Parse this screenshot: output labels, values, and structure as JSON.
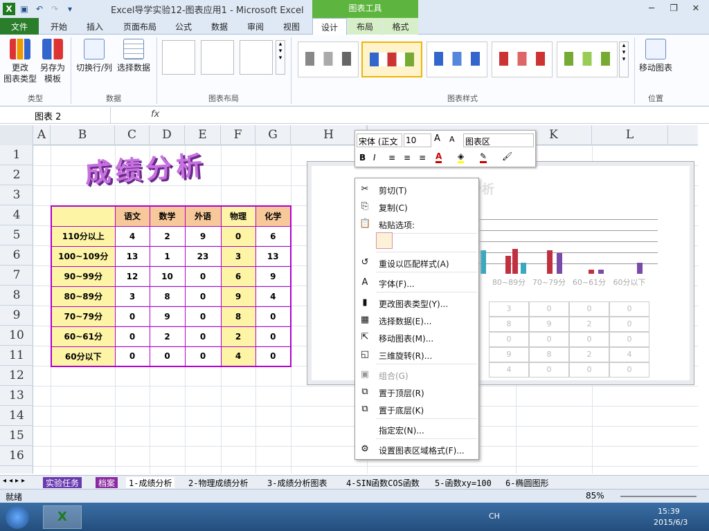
{
  "window": {
    "title": "Excel导学实验12-图表应用1  -  Microsoft Excel",
    "chart_tools_label": "图表工具"
  },
  "tabs": [
    "文件",
    "开始",
    "插入",
    "页面布局",
    "公式",
    "数据",
    "审阅",
    "视图",
    "设计",
    "布局",
    "格式"
  ],
  "ribbon": {
    "change_type": "更改\n图表类型",
    "save_template": "另存为\n模板",
    "group_type": "类型",
    "switch_rowcol": "切换行/列",
    "select_data": "选择数据",
    "group_data": "数据",
    "group_layout": "图表布局",
    "group_style": "图表样式",
    "move_chart": "移动图表",
    "group_position": "位置"
  },
  "formula_bar": {
    "name": "图表 2",
    "fx": "fx"
  },
  "columns": [
    "A",
    "B",
    "C",
    "D",
    "E",
    "F",
    "G",
    "H",
    "I",
    "J",
    "K",
    "L"
  ],
  "rows": [
    "1",
    "2",
    "3",
    "4",
    "5",
    "6",
    "7",
    "8",
    "9",
    "10",
    "11",
    "12",
    "13",
    "14",
    "15",
    "16"
  ],
  "sheet_title": "成绩分析",
  "table": {
    "headers": [
      "语文",
      "数学",
      "外语",
      "物理",
      "化学"
    ],
    "rows": [
      {
        "label": "110分以上",
        "values": [
          "4",
          "2",
          "9",
          "0",
          "6"
        ]
      },
      {
        "label": "100~109分",
        "values": [
          "13",
          "1",
          "23",
          "3",
          "13"
        ]
      },
      {
        "label": "90~99分",
        "values": [
          "12",
          "10",
          "0",
          "6",
          "9"
        ]
      },
      {
        "label": "80~89分",
        "values": [
          "3",
          "8",
          "0",
          "9",
          "4"
        ]
      },
      {
        "label": "70~79分",
        "values": [
          "0",
          "9",
          "0",
          "8",
          "0"
        ]
      },
      {
        "label": "60~61分",
        "values": [
          "0",
          "2",
          "0",
          "2",
          "0"
        ]
      },
      {
        "label": "60分以下",
        "values": [
          "0",
          "0",
          "0",
          "4",
          "0"
        ]
      }
    ]
  },
  "chart": {
    "title": "绩分析",
    "cats": [
      "80~89分",
      "70~79分",
      "60~61分",
      "60分以下"
    ],
    "table_rows": [
      [
        "3",
        "0",
        "0",
        "0"
      ],
      [
        "8",
        "9",
        "2",
        "0"
      ],
      [
        "0",
        "0",
        "0",
        "0"
      ],
      [
        "9",
        "8",
        "2",
        "4"
      ],
      [
        "4",
        "0",
        "0",
        "0"
      ]
    ]
  },
  "mini_toolbar": {
    "font": "宋体 (正文",
    "size": "10",
    "area": "图表区"
  },
  "menu": [
    {
      "label": "剪切(T)",
      "icon": "✂"
    },
    {
      "label": "复制(C)",
      "icon": "⎘"
    },
    {
      "label": "粘贴选项:",
      "icon": "📋"
    },
    {
      "label": "重设以匹配样式(A)",
      "icon": "↺"
    },
    {
      "label": "字体(F)...",
      "icon": "A"
    },
    {
      "label": "更改图表类型(Y)...",
      "icon": "▮"
    },
    {
      "label": "选择数据(E)...",
      "icon": "▦"
    },
    {
      "label": "移动图表(M)...",
      "icon": "⇱"
    },
    {
      "label": "三维旋转(R)...",
      "icon": "◱"
    },
    {
      "label": "组合(G)",
      "icon": "▣"
    },
    {
      "label": "置于顶层(R)",
      "icon": "⧉"
    },
    {
      "label": "置于底层(K)",
      "icon": "⧉"
    },
    {
      "label": "指定宏(N)...",
      "icon": ""
    },
    {
      "label": "设置图表区域格式(F)...",
      "icon": "⚙"
    }
  ],
  "sheet_tabs": [
    "实验任务",
    "档案",
    "1-成绩分析",
    "2-物理成绩分析",
    "3-成绩分析图表",
    "4-SIN函数COS函数",
    "5-函数xy=100",
    "6-椭圆图形"
  ],
  "status": {
    "ready": "就绪",
    "zoom": "85%"
  },
  "taskbar": {
    "lang": "CH",
    "time": "15:39",
    "date": "2015/6/3"
  }
}
